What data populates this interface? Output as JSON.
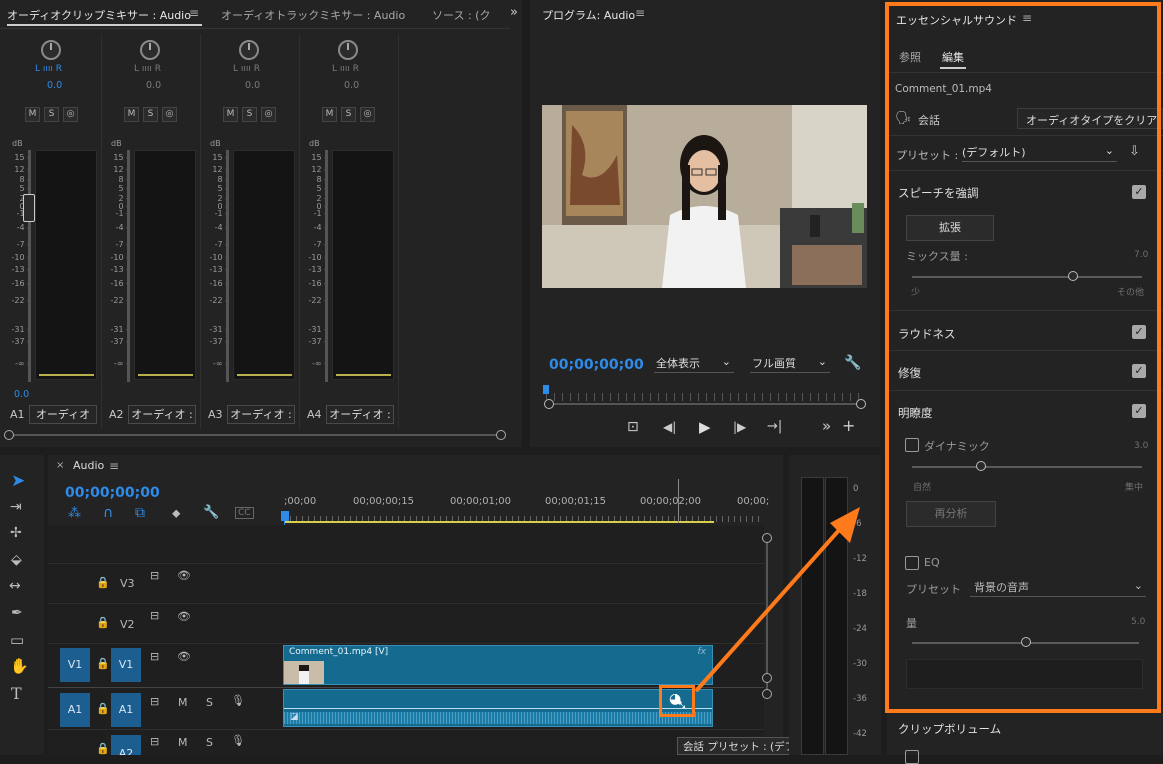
{
  "mixer": {
    "tabs": [
      "オーディオクリップミキサー : Audio",
      "オーディオトラックミキサー : Audio",
      "ソース : (ク"
    ],
    "db_label": "dB",
    "db_scale": [
      "15 -",
      "12 -",
      "8 -",
      "5 -",
      "2 -",
      "0 -",
      "-1 -",
      "-4 -",
      "-7 -",
      "-10 -",
      "-13 -",
      "-16 -",
      "-22 -",
      "-31 -",
      "-37 -",
      "-∞ -"
    ],
    "channels": [
      {
        "id": "A1",
        "name": "オーディオ",
        "value": "0.0",
        "active": true
      },
      {
        "id": "A2",
        "name": "オーディオ :",
        "value": "0.0",
        "active": false
      },
      {
        "id": "A3",
        "name": "オーディオ :",
        "value": "0.0",
        "active": false
      },
      {
        "id": "A4",
        "name": "オーディオ :",
        "value": "0.0",
        "active": false
      }
    ],
    "m": "M",
    "s": "S",
    "l": "L",
    "r": "R",
    "fader_readout": "0.0"
  },
  "program": {
    "title": "プログラム: Audio",
    "timecode": "00;00;00;00",
    "zoom": "全体表示",
    "quality": "フル画質"
  },
  "timeline": {
    "title": "Audio",
    "timecode": "00;00;00;00",
    "ruler": [
      ";00;00",
      "00;00;00;15",
      "00;00;01;00",
      "00;00;01;15",
      "00;00;02;00",
      "00;00;"
    ],
    "tracks": [
      {
        "id": "V3"
      },
      {
        "id": "V2"
      },
      {
        "id": "V1",
        "source": "V1"
      },
      {
        "id": "A1",
        "source": "A1"
      },
      {
        "id": "A2"
      }
    ],
    "video_clip": "Comment_01.mp4 [V]",
    "fx": "fx",
    "tooltip": "会話 プリセット : (デフォルト)",
    "meter_scale": [
      "0",
      "-6",
      "-12",
      "-18",
      "-24",
      "-30",
      "-36",
      "-42"
    ]
  },
  "essential_sound": {
    "title": "エッセンシャルサウンド",
    "tab_browse": "参照",
    "tab_edit": "編集",
    "clip_name": "Comment_01.mp4",
    "type": "会話",
    "clear_type": "オーディオタイプをクリア",
    "preset_label": "プリセット :",
    "preset_value": "(デフォルト)",
    "enhance_speech": "スピーチを強調",
    "expand": "拡張",
    "mix_amount": "ミックス量 :",
    "mix_value": "7.0",
    "mix_level": 0.7,
    "mix_less": "少",
    "mix_more": "その他",
    "loudness": "ラウドネス",
    "repair": "修復",
    "clarity": "明瞭度",
    "dynamics": "ダイナミック",
    "dynamics_value": "3.0",
    "dynamics_level": 0.3,
    "natural": "自然",
    "focused": "集中",
    "reanalyze": "再分析",
    "eq": "EQ",
    "eq_preset_label": "プリセット",
    "eq_preset_value": "背景の音声",
    "amount": "量",
    "amount_value": "5.0",
    "amount_level": 0.5,
    "clip_volume": "クリップボリューム"
  },
  "colors": {
    "accent": "#ff7a1a",
    "blue": "#2e8be8",
    "track": "#1b5e8f",
    "clip": "#156b8f"
  }
}
